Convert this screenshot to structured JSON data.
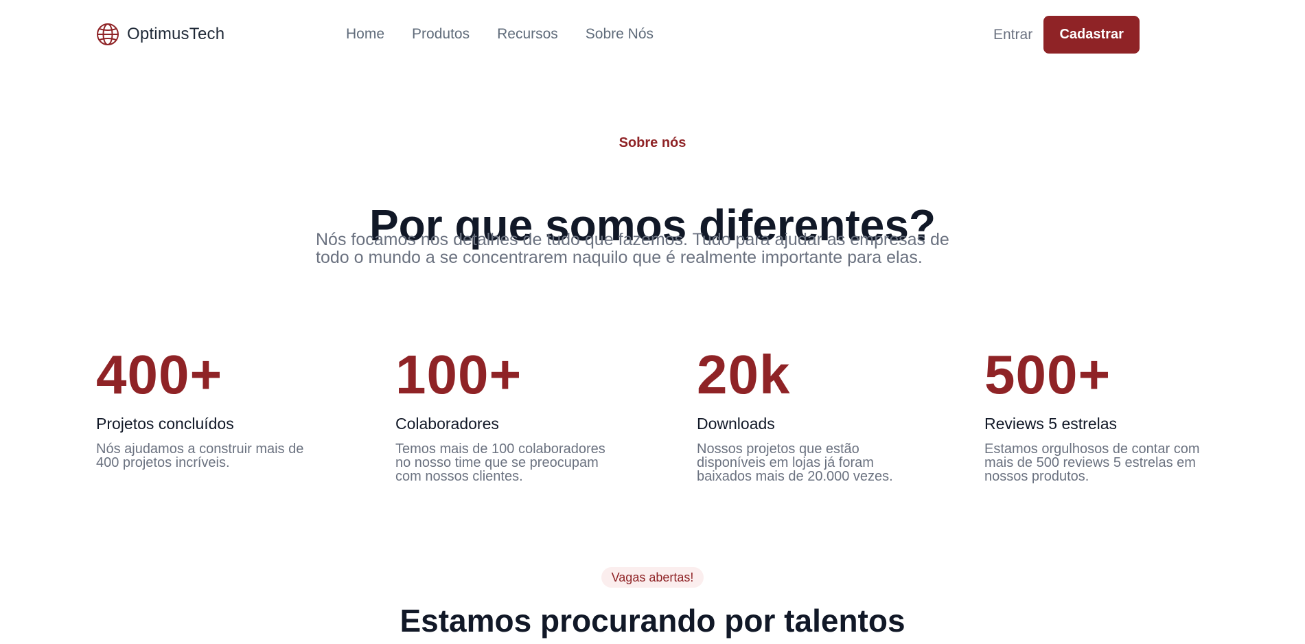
{
  "header": {
    "brand": "OptimusTech",
    "brand_icon": "globe-icon",
    "nav": [
      "Home",
      "Produtos",
      "Recursos",
      "Sobre Nós"
    ],
    "login_label": "Entrar",
    "signup_label": "Cadastrar"
  },
  "about": {
    "eyebrow": "Sobre nós",
    "title": "Por que somos diferentes?",
    "subtitle_line1": "Nós focamos nos detalhes de tudo que fazemos. Tudo para ajudar as empresas de",
    "subtitle_line2": "todo o mundo a se concentrarem naquilo que é realmente importante para elas."
  },
  "stats": [
    {
      "value": "400+",
      "label": "Projetos concluídos",
      "desc_lines": [
        "Nós ajudamos a construir mais de",
        "400 projetos incríveis."
      ]
    },
    {
      "value": "100+",
      "label": "Colaboradores",
      "desc_lines": [
        "Temos mais de 100 colaboradores",
        "no nosso time que se preocupam",
        "com nossos clientes."
      ]
    },
    {
      "value": "20k",
      "label": "Downloads",
      "desc_lines": [
        "Nossos projetos que estão",
        "disponíveis em lojas já foram",
        "baixados mais de 20.000 vezes."
      ]
    },
    {
      "value": "500+",
      "label": "Reviews 5 estrelas",
      "desc_lines": [
        "Estamos orgulhosos de contar com",
        "mais de 500 reviews 5 estrelas em",
        "nossos produtos."
      ]
    }
  ],
  "careers": {
    "badge": "Vagas abertas!",
    "title": "Estamos procurando por talentos"
  },
  "colors": {
    "accent": "#8f2326",
    "heading": "#111827",
    "muted": "#6b7280"
  }
}
